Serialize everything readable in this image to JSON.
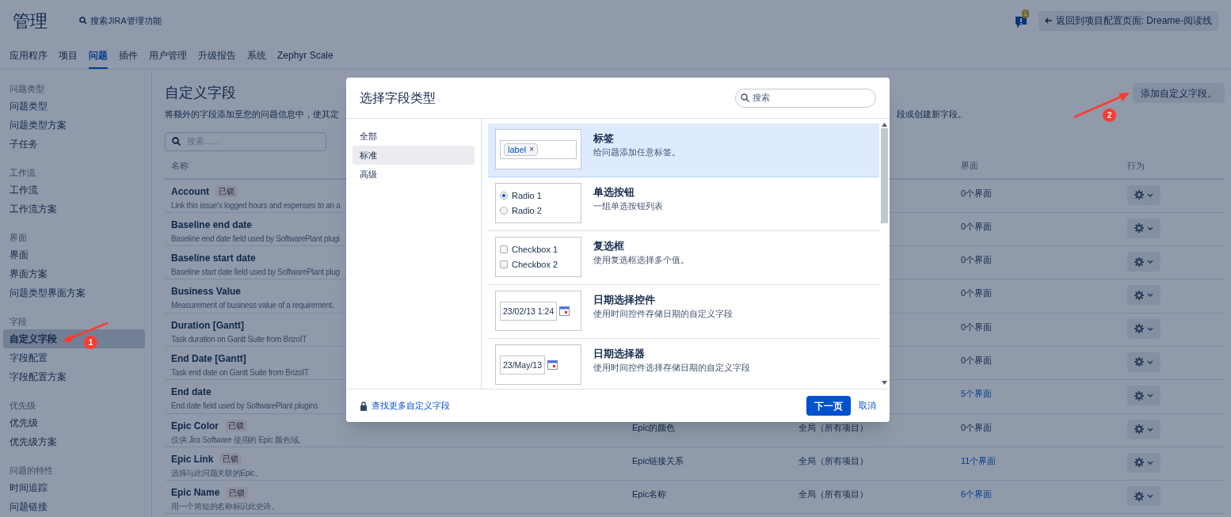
{
  "header": {
    "title": "管理",
    "search": "搜索JIRA管理功能",
    "notification_count": "1",
    "back_button": "返回到项目配置页面: Dreame-阅读线"
  },
  "nav_tabs": [
    {
      "label": "应用程序",
      "selected": false
    },
    {
      "label": "项目",
      "selected": false
    },
    {
      "label": "问题",
      "selected": true
    },
    {
      "label": "插件",
      "selected": false
    },
    {
      "label": "用户管理",
      "selected": false
    },
    {
      "label": "升级报告",
      "selected": false
    },
    {
      "label": "系统",
      "selected": false
    },
    {
      "label": "Zephyr Scale",
      "selected": false
    }
  ],
  "sidebar": [
    {
      "heading": "问题类型",
      "items": [
        {
          "label": "问题类型",
          "selected": false
        },
        {
          "label": "问题类型方案",
          "selected": false
        },
        {
          "label": "子任务",
          "selected": false
        }
      ]
    },
    {
      "heading": "工作流",
      "items": [
        {
          "label": "工作流",
          "selected": false
        },
        {
          "label": "工作流方案",
          "selected": false
        }
      ]
    },
    {
      "heading": "界面",
      "items": [
        {
          "label": "界面",
          "selected": false
        },
        {
          "label": "界面方案",
          "selected": false
        },
        {
          "label": "问题类型界面方案",
          "selected": false
        }
      ]
    },
    {
      "heading": "字段",
      "items": [
        {
          "label": "自定义字段",
          "selected": true
        },
        {
          "label": "字段配置",
          "selected": false
        },
        {
          "label": "字段配置方案",
          "selected": false
        }
      ]
    },
    {
      "heading": "优先级",
      "items": [
        {
          "label": "优先级",
          "selected": false
        },
        {
          "label": "优先级方案",
          "selected": false
        }
      ]
    },
    {
      "heading": "问题的特性",
      "items": [
        {
          "label": "时间追踪",
          "selected": false
        },
        {
          "label": "问题链接",
          "selected": false
        }
      ]
    }
  ],
  "main": {
    "title": "自定义字段",
    "description_start": "将额外的字段添加至您的问题信息中，使其定",
    "description_end": "段或创建新字段。",
    "add_button": "添加自定义字段。",
    "search_placeholder": "搜索......"
  },
  "table": {
    "columns": {
      "name": "名称",
      "screens": "界面",
      "actions": "行为"
    },
    "rows": [
      {
        "name": "Account",
        "badge": "已锁",
        "description": "Link this issue's logged hours and expenses to an a",
        "screens": "0个界面",
        "linked": false
      },
      {
        "name": "Baseline end date",
        "description": "Baseline end date field used by SoftwarePlant plugi",
        "screens": "0个界面",
        "linked": false
      },
      {
        "name": "Baseline start date",
        "description": "Baseline start date field used by SoftwarePlant plug",
        "screens": "0个界面",
        "linked": false
      },
      {
        "name": "Business Value",
        "description": "Measurement of business value of a requirement.",
        "screens": "0个界面",
        "linked": false
      },
      {
        "name": "Duration [Gantt]",
        "description": "Task duration on Gantt Suite from BrizoIT",
        "screens": "0个界面",
        "linked": false
      },
      {
        "name": "End Date [Gantt]",
        "description": "Task end date on Gantt Suite from BrizoIT",
        "screens": "0个界面",
        "linked": false
      },
      {
        "name": "End date",
        "description": "End date field used by SoftwarePlant plugins",
        "screens": "5个界面",
        "linked": true
      },
      {
        "name": "Epic Color",
        "badge": "已锁",
        "description": "仅供 Jira Software 使用的 Epic 颜色域。",
        "type": "Epic的颜色",
        "context": "全局（所有项目）",
        "screens": "0个界面",
        "linked": false
      },
      {
        "name": "Epic Link",
        "badge": "已锁",
        "description": "选择与此问题关联的Epic。",
        "type": "Epic链接关系",
        "context": "全局（所有项目）",
        "screens": "11个界面",
        "linked": true
      },
      {
        "name": "Epic Name",
        "badge": "已锁",
        "description": "用一个简短的名称标识此史诗。",
        "type": "Epic名称",
        "context": "全局（所有项目）",
        "screens": "6个界面",
        "linked": true
      }
    ]
  },
  "dialog": {
    "title": "选择字段类型",
    "search_placeholder": "搜索",
    "categories": [
      {
        "label": "全部",
        "selected": false
      },
      {
        "label": "标准",
        "selected": true
      },
      {
        "label": "高级",
        "selected": false
      }
    ],
    "field_types": [
      {
        "kind": "labels",
        "title": "标签",
        "description": "给问题添加任意标签。",
        "selected": true,
        "preview": [
          {
            "label": "label",
            "remove": "×"
          }
        ]
      },
      {
        "kind": "radio",
        "title": "单选按钮",
        "description": "一组单选按钮列表",
        "selected": false,
        "preview": [
          {
            "label": "Radio 1",
            "checked": true
          },
          {
            "label": "Radio 2",
            "checked": false
          }
        ]
      },
      {
        "kind": "checkbox",
        "title": "复选框",
        "description": "使用复选框选择多个值。",
        "selected": false,
        "preview": [
          {
            "label": "Checkbox 1",
            "checked": false
          },
          {
            "label": "Checkbox 2",
            "checked": false
          }
        ]
      },
      {
        "kind": "date",
        "title": "日期选择控件",
        "description": "使用时间控件存储日期的自定义字段",
        "selected": false,
        "preview": [
          {
            "label": "23/02/13 1:24"
          }
        ]
      },
      {
        "kind": "date",
        "title": "日期选择器",
        "description": "使用时间控件选择存储日期的自定义字段",
        "selected": false,
        "preview": [
          {
            "label": "23/May/13"
          }
        ]
      }
    ],
    "footer_link": "查找更多自定义字段",
    "next_button": "下一页",
    "cancel_button": "取消"
  },
  "annotations": [
    {
      "label": "1"
    },
    {
      "label": "2"
    }
  ]
}
